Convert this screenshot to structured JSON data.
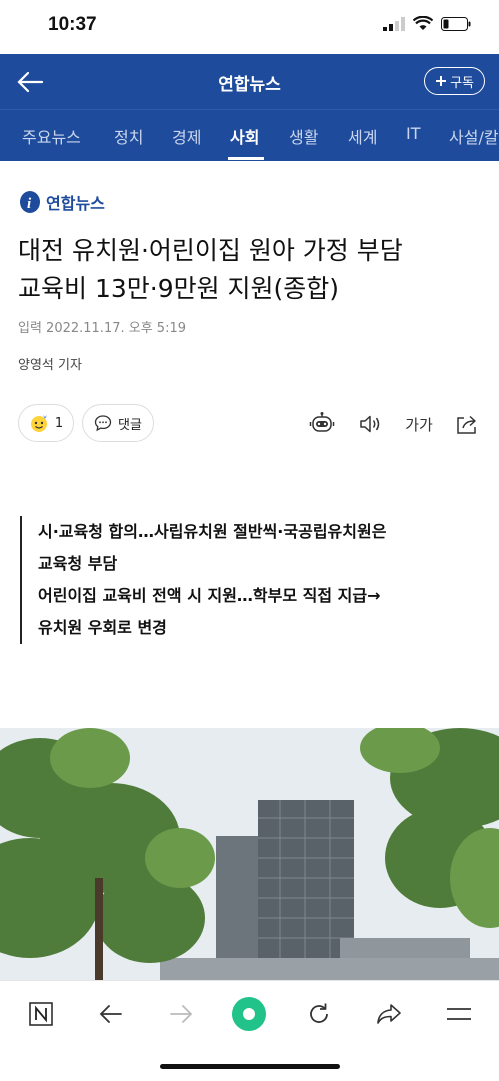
{
  "status": {
    "time": "10:37"
  },
  "header": {
    "title": "연합뉴스",
    "subscribe_label": "구독"
  },
  "nav": {
    "items": [
      "주요뉴스",
      "정치",
      "경제",
      "사회",
      "생활",
      "세계",
      "IT",
      "사설/칼"
    ],
    "active": "사회"
  },
  "article": {
    "source": "연합뉴스",
    "title_line1": "대전 유치원·어린이집 원아 가정 부담",
    "title_line2": "교육비 13만·9만원 지원(종합)",
    "date": "입력 2022.11.17. 오후 5:19",
    "reporter": "양영석 기자",
    "reaction_count": "1",
    "comment_label": "댓글",
    "font_label": "가가",
    "summary": [
      "시·교육청 합의…사립유치원 절반씩·국공립유치원은",
      "교육청 부담",
      "어린이집 교육비 전액 시 지원…학부모 직접 지급→",
      "유치원 우회로 변경"
    ]
  },
  "colors": {
    "brand": "#1e4b9c",
    "green": "#21c38a"
  },
  "icons": [
    "back-arrow-icon",
    "plus-icon",
    "robot-icon",
    "speaker-icon",
    "share-icon",
    "comment-icon",
    "naver-icon",
    "refresh-icon",
    "forward-icon",
    "menu-icon"
  ]
}
